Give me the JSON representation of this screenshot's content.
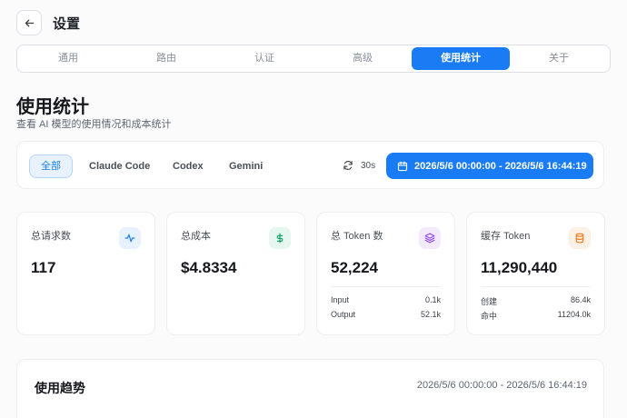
{
  "header": {
    "title": "设置",
    "back_icon": "arrow-left-icon"
  },
  "tabs": [
    {
      "label": "通用",
      "active": false
    },
    {
      "label": "路由",
      "active": false
    },
    {
      "label": "认证",
      "active": false
    },
    {
      "label": "高级",
      "active": false
    },
    {
      "label": "使用统计",
      "active": true
    },
    {
      "label": "关于",
      "active": false
    }
  ],
  "section": {
    "title": "使用统计",
    "subtitle": "查看 AI 模型的使用情况和成本统计"
  },
  "filters": {
    "chips": [
      {
        "label": "全部",
        "active": true
      },
      {
        "label": "Claude Code",
        "active": false
      },
      {
        "label": "Codex",
        "active": false
      },
      {
        "label": "Gemini",
        "active": false
      }
    ],
    "refresh_label": "30s",
    "refresh_icon": "refresh-icon",
    "date_range": "2026/5/6 00:00:00 - 2026/5/6 16:44:19",
    "date_icon": "calendar-icon"
  },
  "cards": {
    "requests": {
      "label": "总请求数",
      "value": "117",
      "icon": "activity-icon",
      "color": "#1a7cf5",
      "bg": "#e8f2fe"
    },
    "cost": {
      "label": "总成本",
      "value": "$4.8334",
      "icon": "dollar-icon",
      "color": "#16a36a",
      "bg": "#e6f7ef"
    },
    "tokens": {
      "label": "总 Token 数",
      "value": "52,224",
      "icon": "layers-icon",
      "color": "#8b46e8",
      "bg": "#f3eafd",
      "rows": [
        {
          "k": "Input",
          "v": "0.1k"
        },
        {
          "k": "Output",
          "v": "52.1k"
        }
      ]
    },
    "cache": {
      "label": "缓存 Token",
      "value": "11,290,440",
      "icon": "database-icon",
      "color": "#f07a1a",
      "bg": "#fdf0e4",
      "rows": [
        {
          "k": "创建",
          "v": "86.4k"
        },
        {
          "k": "命中",
          "v": "11204.0k"
        }
      ]
    }
  },
  "trend": {
    "title": "使用趋势",
    "range": "2026/5/6 00:00:00 - 2026/5/6 16:44:19"
  }
}
